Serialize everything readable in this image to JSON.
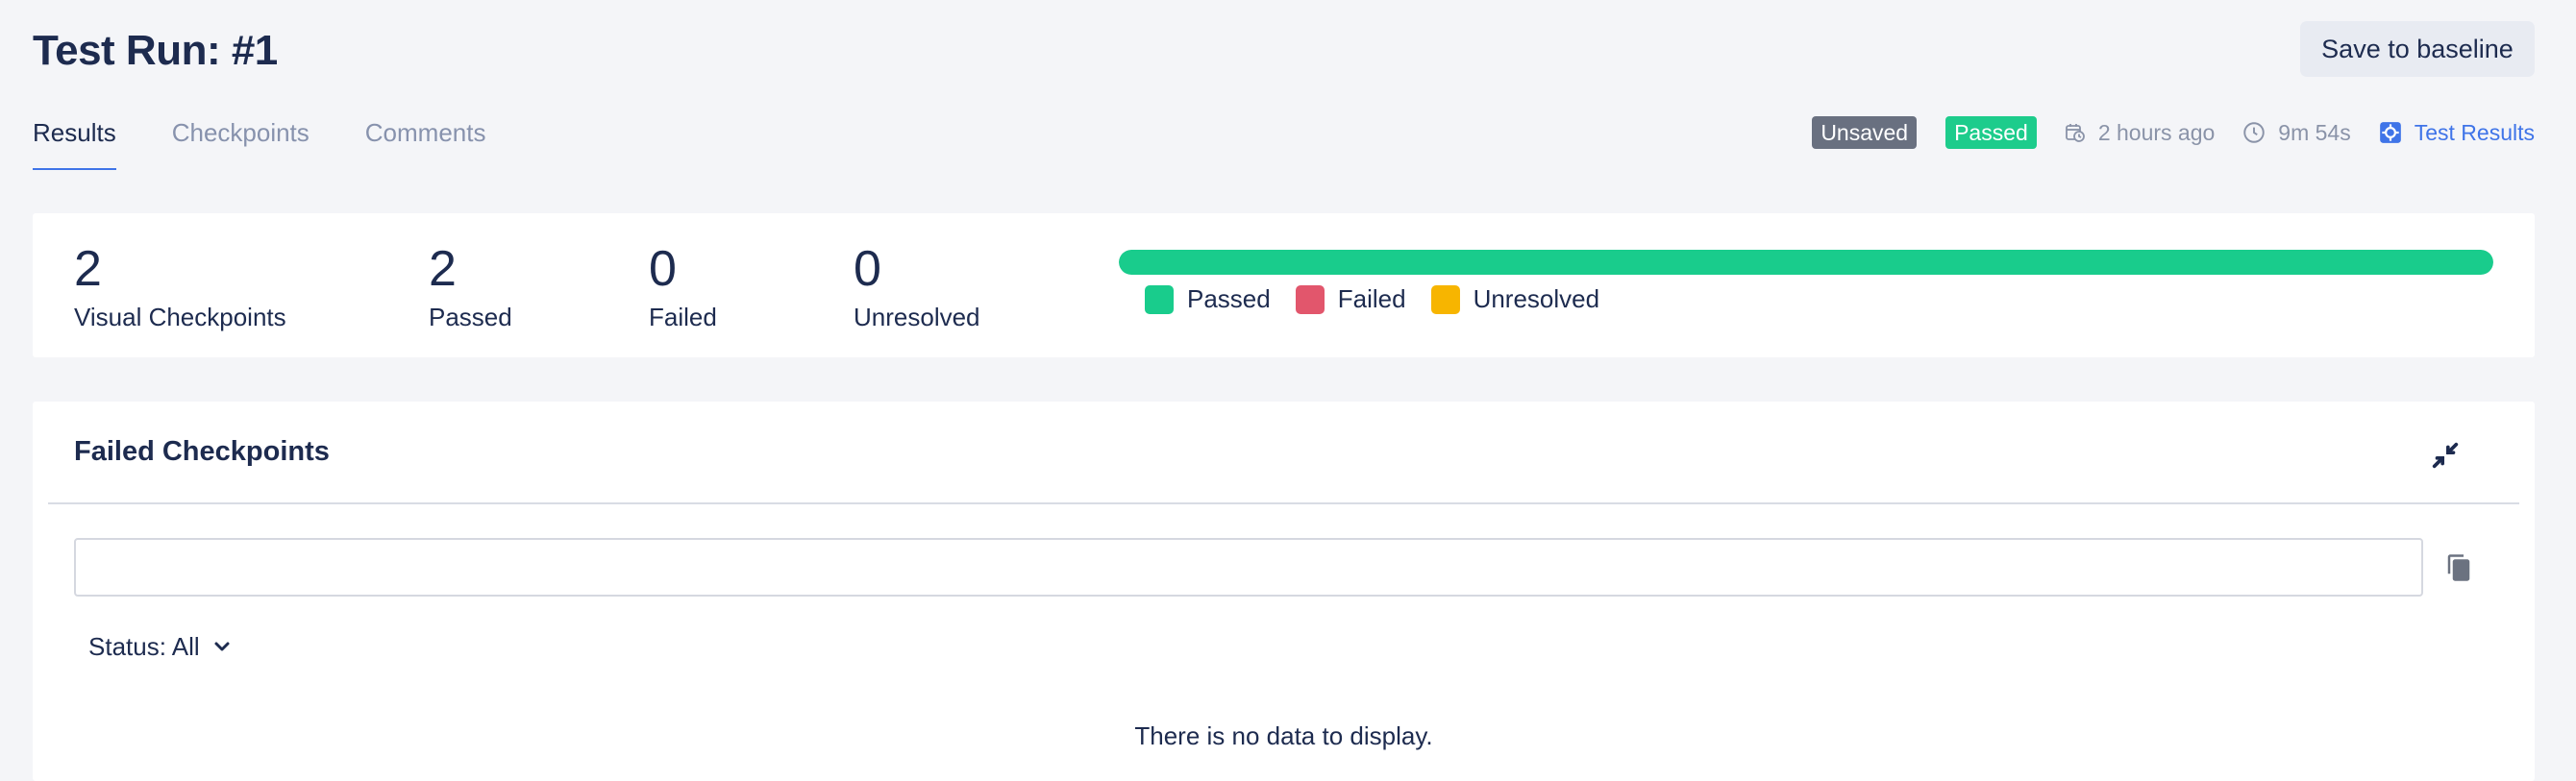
{
  "header": {
    "title": "Test Run: #1",
    "save_button": "Save to baseline"
  },
  "tabs": [
    {
      "label": "Results",
      "active": true
    },
    {
      "label": "Checkpoints",
      "active": false
    },
    {
      "label": "Comments",
      "active": false
    }
  ],
  "status": {
    "unsaved_badge": "Unsaved",
    "passed_badge": "Passed",
    "time_ago": "2 hours ago",
    "duration": "9m 54s",
    "test_results_link": "Test Results",
    "icons": [
      "calendar-clock-icon",
      "clock-icon",
      "test-results-icon"
    ]
  },
  "summary": {
    "stats": [
      {
        "value": "2",
        "label": "Visual Checkpoints"
      },
      {
        "value": "2",
        "label": "Passed"
      },
      {
        "value": "0",
        "label": "Failed"
      },
      {
        "value": "0",
        "label": "Unresolved"
      }
    ],
    "progress": {
      "passed_fraction": 1.0,
      "failed_fraction": 0.0,
      "unresolved_fraction": 0.0
    },
    "legend": [
      {
        "label": "Passed",
        "color": "#19cc8c"
      },
      {
        "label": "Failed",
        "color": "#e2566c"
      },
      {
        "label": "Unresolved",
        "color": "#f7b500"
      }
    ]
  },
  "failed_panel": {
    "title": "Failed Checkpoints",
    "search_value": "",
    "search_placeholder": "",
    "filter_label": "Status: All",
    "empty_message": "There is no data to display.",
    "icons": [
      "collapse-icon",
      "copy-icon",
      "chevron-down-icon"
    ]
  },
  "colors": {
    "accent": "#3f74e8",
    "passed": "#1dcc8c",
    "unsaved": "#697080",
    "text": "#1d2b4f"
  }
}
